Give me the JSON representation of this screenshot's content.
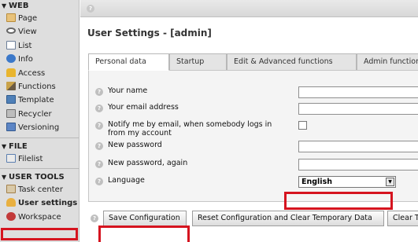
{
  "sidebar": {
    "sections": [
      {
        "title": "WEB",
        "items": [
          {
            "label": "Page",
            "icon": "page-icon",
            "color": "#e0a93a"
          },
          {
            "label": "View",
            "icon": "view-icon",
            "color": "#8a8a8a"
          },
          {
            "label": "List",
            "icon": "list-icon",
            "color": "#9aa7b8"
          },
          {
            "label": "Info",
            "icon": "info-icon",
            "color": "#3b78c9"
          },
          {
            "label": "Access",
            "icon": "access-icon",
            "color": "#e9b52f"
          },
          {
            "label": "Functions",
            "icon": "functions-icon",
            "color": "#7a6a4e"
          },
          {
            "label": "Template",
            "icon": "template-icon",
            "color": "#4f80b8"
          },
          {
            "label": "Recycler",
            "icon": "recycler-icon",
            "color": "#8a8a8a"
          },
          {
            "label": "Versioning",
            "icon": "versioning-icon",
            "color": "#5c85c5"
          }
        ]
      },
      {
        "title": "FILE",
        "items": [
          {
            "label": "Filelist",
            "icon": "filelist-icon",
            "color": "#5c7fb0"
          }
        ]
      },
      {
        "title": "USER TOOLS",
        "items": [
          {
            "label": "Task center",
            "icon": "task-center-icon",
            "color": "#c9924a"
          },
          {
            "label": "User settings",
            "icon": "user-settings-icon",
            "color": "#e0a93a",
            "active": true
          },
          {
            "label": "Workspace",
            "icon": "workspace-icon",
            "color": "#c23a3a"
          }
        ]
      }
    ]
  },
  "page": {
    "title": "User Settings - [admin]"
  },
  "tabs": [
    {
      "label": "Personal data",
      "active": true
    },
    {
      "label": "Startup"
    },
    {
      "label": "Edit & Advanced functions"
    },
    {
      "label": "Admin functions"
    }
  ],
  "form": {
    "name_label": "Your name",
    "name_value": "",
    "email_label": "Your email address",
    "email_value": "",
    "notify_label": "Notify me by email, when somebody logs in from my account",
    "notify_checked": false,
    "password_label": "New password",
    "password_value": "",
    "password_again_label": "New password, again",
    "password_again_value": "",
    "language_label": "Language",
    "language_value": "English"
  },
  "buttons": {
    "save": "Save Configuration",
    "reset": "Reset Configuration and Clear Temporary Data",
    "clear": "Clear Temporary Data"
  },
  "colors": {
    "highlight": "#d5141f",
    "sidebar_bg": "#dedede"
  }
}
